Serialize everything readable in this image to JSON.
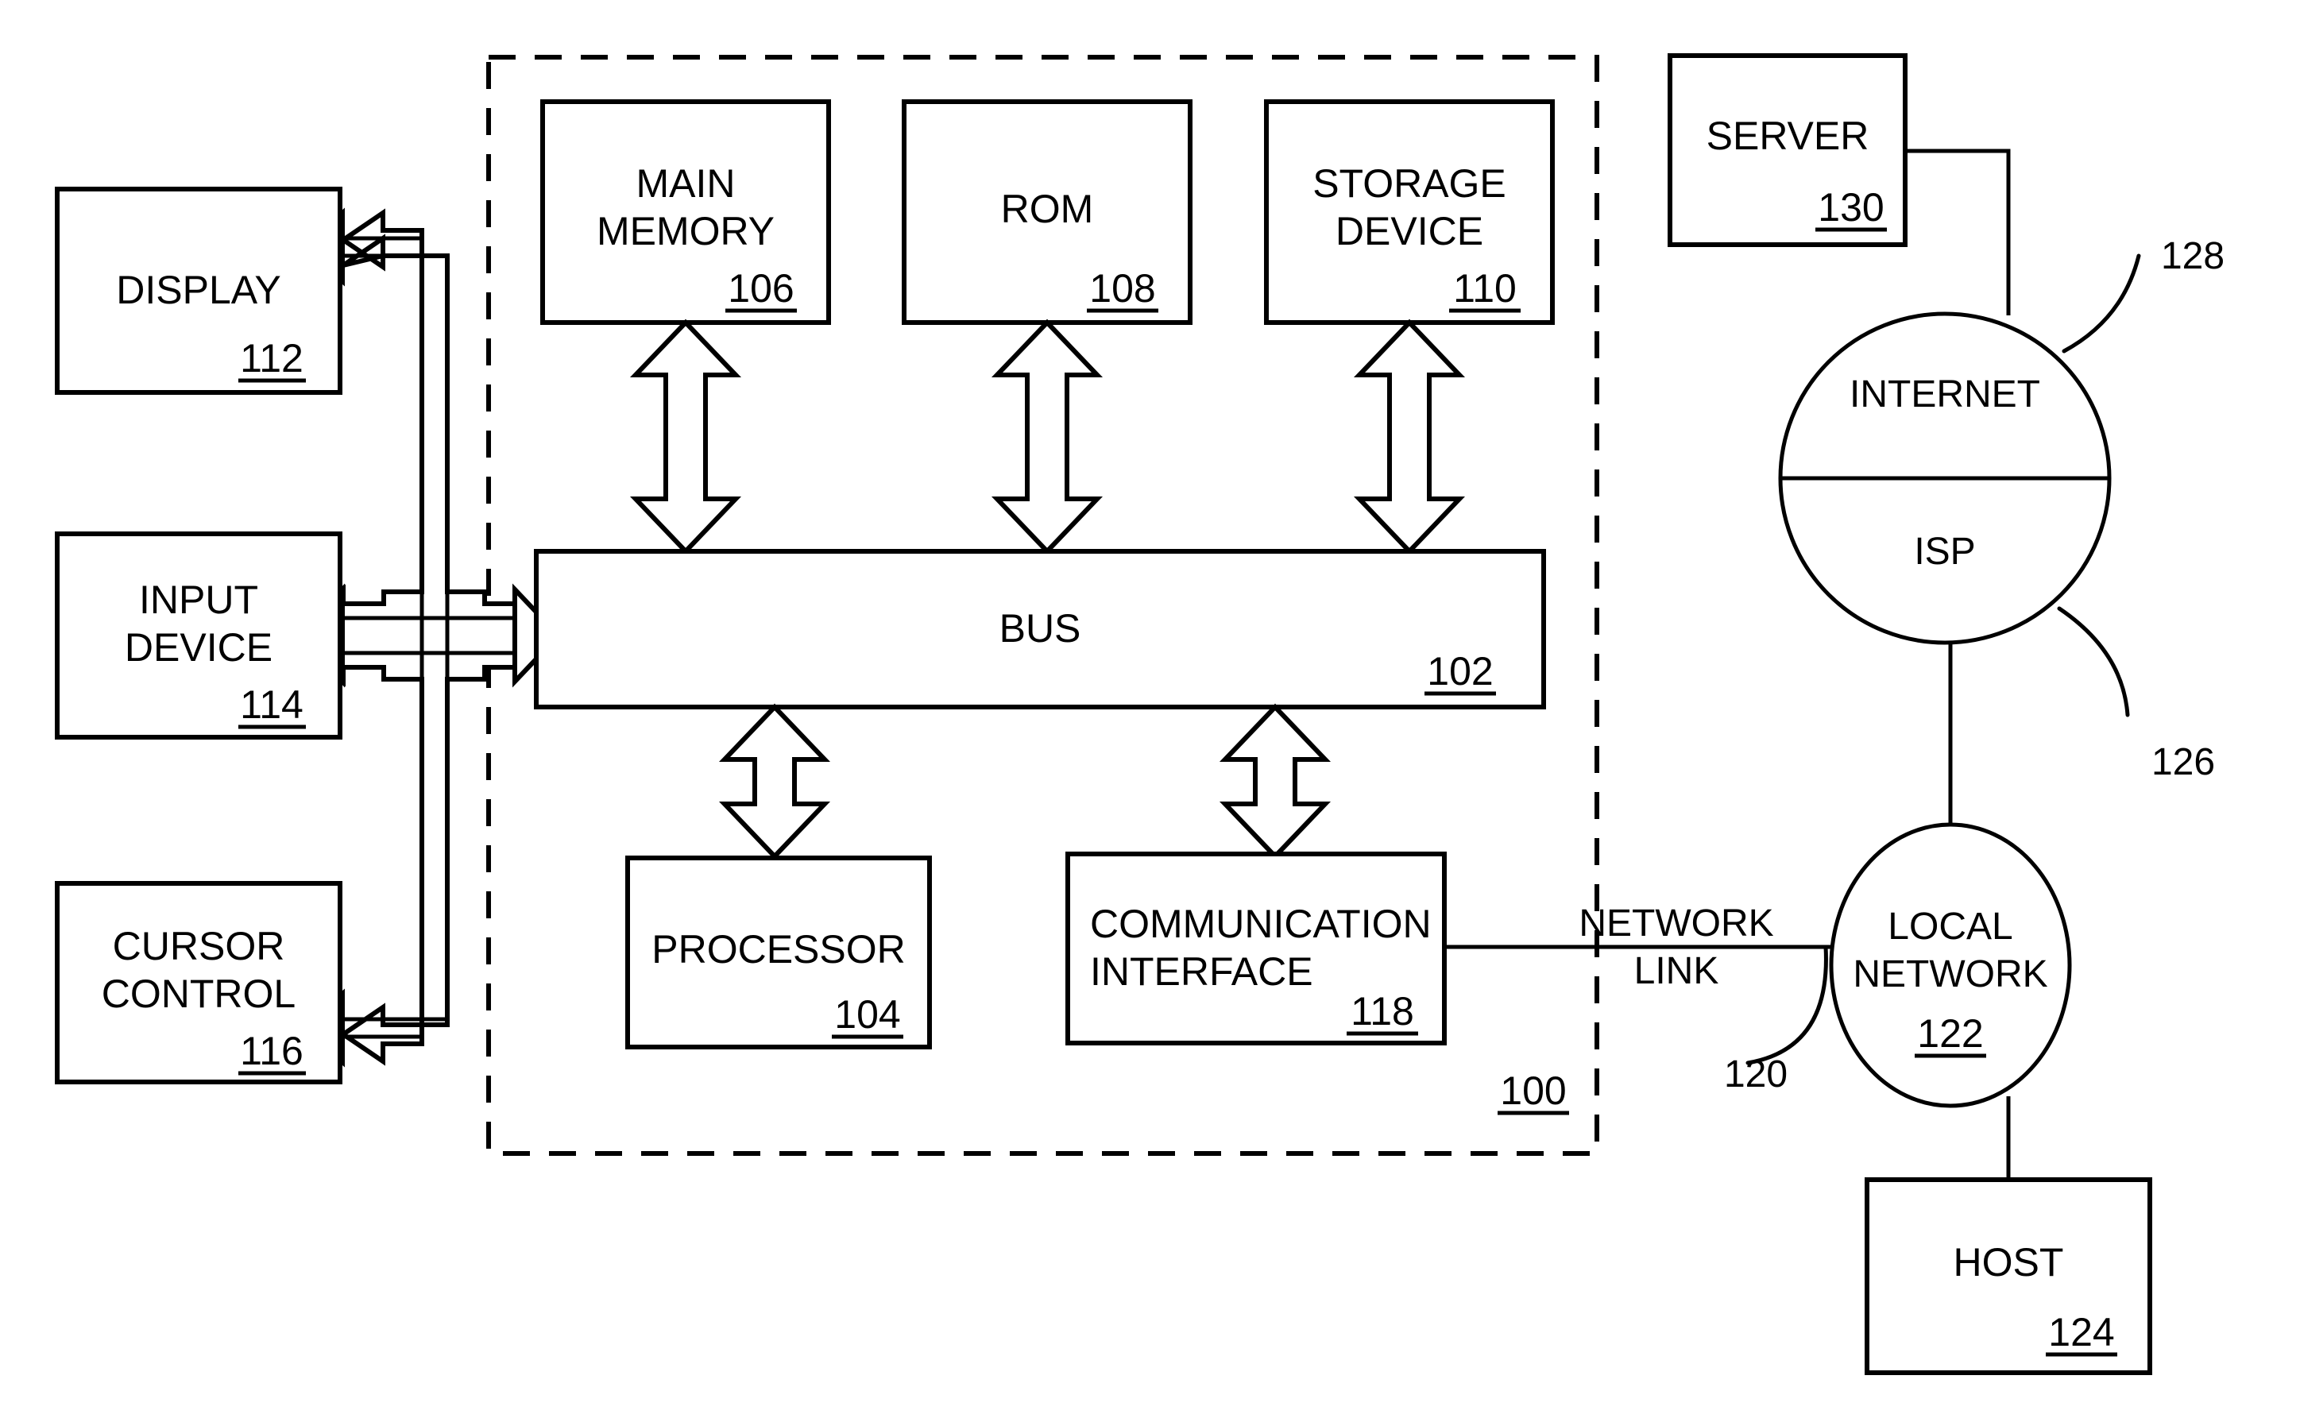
{
  "figure": {
    "title": "Computer system block diagram",
    "system_ref": "100",
    "stroke_color": "#000000",
    "background_color": "#ffffff"
  },
  "boundary": {
    "name": "computer-system-boundary",
    "style": "dashed",
    "ref": "100"
  },
  "blocks": {
    "display": {
      "label": "DISPLAY",
      "ref": "112"
    },
    "input_device": {
      "label_line1": "INPUT",
      "label_line2": "DEVICE",
      "ref": "114"
    },
    "cursor_control": {
      "label_line1": "CURSOR",
      "label_line2": "CONTROL",
      "ref": "116"
    },
    "main_memory": {
      "label_line1": "MAIN",
      "label_line2": "MEMORY",
      "ref": "106"
    },
    "rom": {
      "label": "ROM",
      "ref": "108"
    },
    "storage_device": {
      "label_line1": "STORAGE",
      "label_line2": "DEVICE",
      "ref": "110"
    },
    "bus": {
      "label": "BUS",
      "ref": "102"
    },
    "processor": {
      "label": "PROCESSOR",
      "ref": "104"
    },
    "communication_interface": {
      "label_line1": "COMMUNICATION",
      "label_line2": "INTERFACE",
      "ref": "118"
    },
    "server": {
      "label": "SERVER",
      "ref": "130"
    },
    "host": {
      "label": "HOST",
      "ref": "124"
    }
  },
  "nodes": {
    "internet": {
      "label_top": "INTERNET",
      "label_bottom": "ISP",
      "ref_top": "128",
      "ref_bottom": "126"
    },
    "local_network": {
      "label_line1": "LOCAL",
      "label_line2": "NETWORK",
      "ref": "122"
    }
  },
  "links": {
    "network_link": {
      "label_line1": "NETWORK",
      "label_line2": "LINK",
      "ref": "120"
    }
  }
}
